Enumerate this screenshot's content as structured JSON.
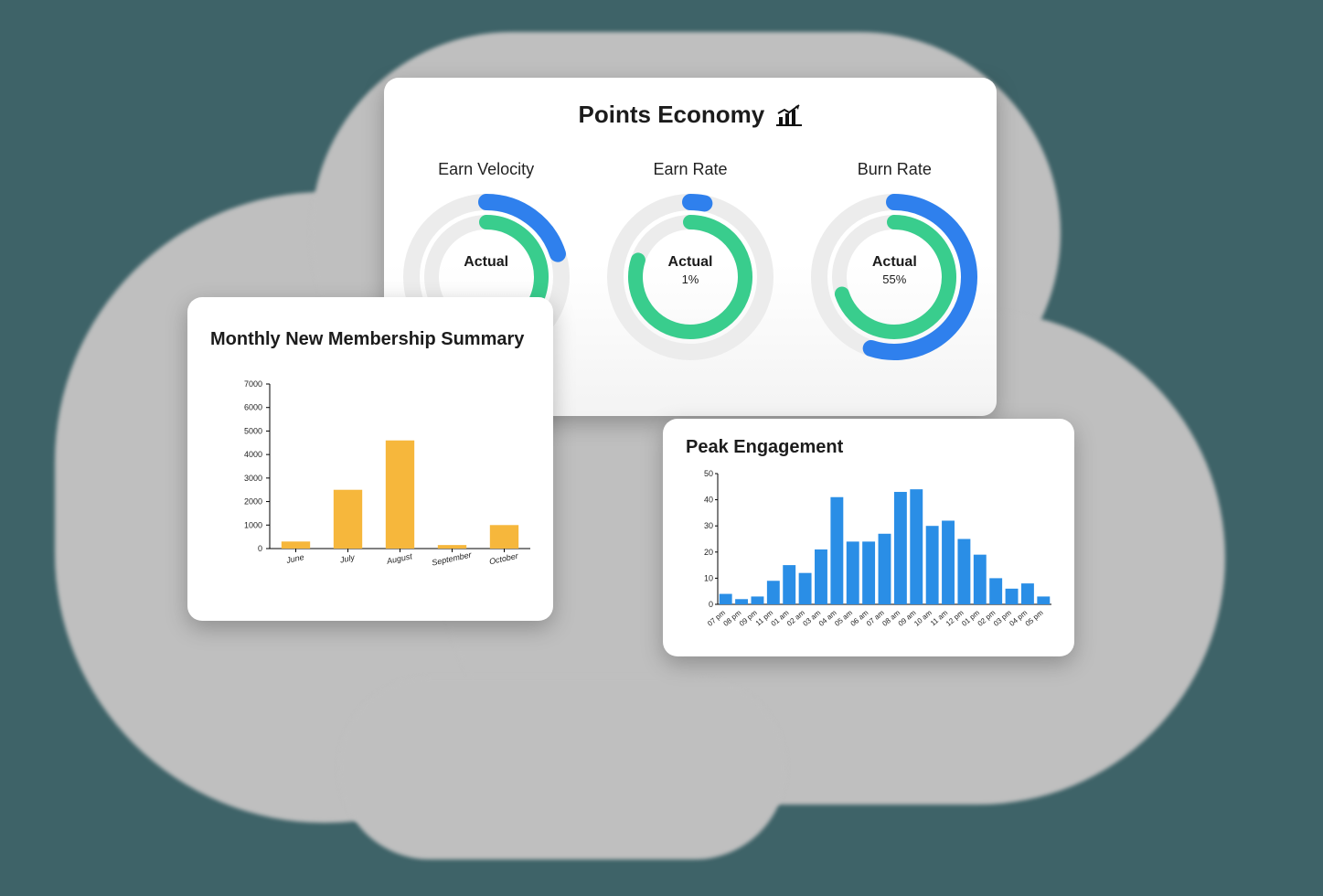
{
  "points_economy": {
    "title": "Points Economy",
    "icon": "bar-growth-icon",
    "colors": {
      "inner": "#39cd8d",
      "outer": "#2f80ed",
      "bg": "#ececec"
    },
    "donuts": [
      {
        "label": "Earn Velocity",
        "center_label": "Actual",
        "center_value": "",
        "outer_pct": 20,
        "inner_pct": 35
      },
      {
        "label": "Earn Rate",
        "center_label": "Actual",
        "center_value": "1%",
        "outer_pct": 3,
        "inner_pct": 80
      },
      {
        "label": "Burn Rate",
        "center_label": "Actual",
        "center_value": "55%",
        "outer_pct": 55,
        "inner_pct": 70
      }
    ]
  },
  "monthly": {
    "title": "Monthly New Membership Summary"
  },
  "peak": {
    "title": "Peak Engagement"
  },
  "chart_data": [
    {
      "id": "points_economy_donuts",
      "type": "donut",
      "series": [
        {
          "name": "Earn Velocity",
          "rings": [
            {
              "name": "outer",
              "value_pct": 20
            },
            {
              "name": "inner",
              "value_pct": 35
            }
          ]
        },
        {
          "name": "Earn Rate",
          "rings": [
            {
              "name": "outer",
              "value_pct": 3
            },
            {
              "name": "inner",
              "value_pct": 80
            }
          ],
          "actual_label": "1%"
        },
        {
          "name": "Burn Rate",
          "rings": [
            {
              "name": "outer",
              "value_pct": 55
            },
            {
              "name": "inner",
              "value_pct": 70
            }
          ],
          "actual_label": "55%"
        }
      ],
      "title": "Points Economy"
    },
    {
      "id": "monthly_membership",
      "type": "bar",
      "title": "Monthly New Membership Summary",
      "categories": [
        "June",
        "July",
        "August",
        "September",
        "October"
      ],
      "values": [
        300,
        2500,
        4600,
        150,
        1000
      ],
      "ylim": [
        0,
        7000
      ],
      "yticks": [
        0,
        1000,
        2000,
        3000,
        4000,
        5000,
        6000,
        7000
      ],
      "xlabel": "",
      "ylabel": ""
    },
    {
      "id": "peak_engagement",
      "type": "bar",
      "title": "Peak Engagement",
      "categories": [
        "07 pm",
        "08 pm",
        "09 pm",
        "11 pm",
        "01 am",
        "02 am",
        "03 am",
        "04 am",
        "05 am",
        "06 am",
        "07 am",
        "08 am",
        "09 am",
        "10 am",
        "11 am",
        "12 pm",
        "01 pm",
        "02 pm",
        "03 pm",
        "04 pm",
        "05 pm"
      ],
      "values": [
        4,
        2,
        3,
        9,
        15,
        12,
        21,
        41,
        24,
        24,
        27,
        43,
        44,
        30,
        32,
        25,
        19,
        10,
        6,
        8,
        3
      ],
      "ylim": [
        0,
        50
      ],
      "yticks": [
        0,
        10,
        20,
        30,
        40,
        50
      ],
      "xlabel": "",
      "ylabel": ""
    }
  ]
}
